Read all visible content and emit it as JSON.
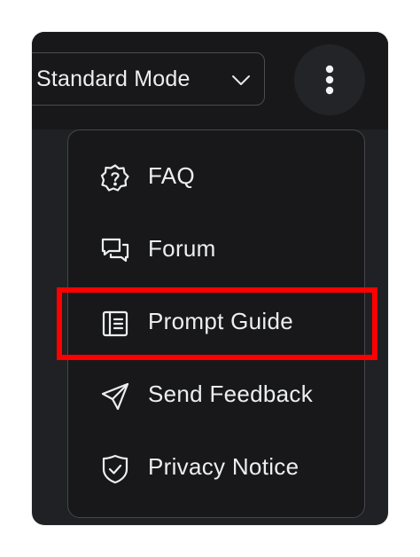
{
  "mode_selector": {
    "label": "Standard Mode",
    "chevron_icon": "chevron-down-icon"
  },
  "more_button": {
    "icon": "vertical-ellipsis-icon"
  },
  "menu": {
    "items": [
      {
        "label": "FAQ",
        "icon": "question-badge-icon"
      },
      {
        "label": "Forum",
        "icon": "chat-bubbles-icon"
      },
      {
        "label": "Prompt Guide",
        "icon": "document-icon"
      },
      {
        "label": "Send Feedback",
        "icon": "send-arrow-icon"
      },
      {
        "label": "Privacy Notice",
        "icon": "shield-check-icon"
      }
    ]
  },
  "highlight": {
    "target": "Prompt Guide",
    "color": "#ff0000"
  },
  "colors": {
    "background": "#18181b",
    "text": "#eceef0",
    "border": "#45474c"
  }
}
